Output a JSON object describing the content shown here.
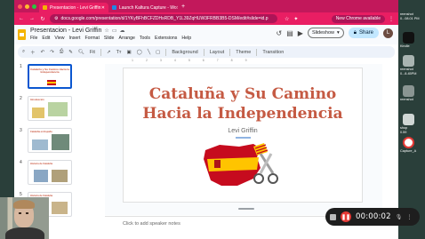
{
  "browser": {
    "tabs": [
      {
        "label": "Presentacion - Levi Griffin",
        "active": true,
        "favicon_color": "#f4b400"
      },
      {
        "label": "Launch Kaltura Capture - Wo",
        "active": false,
        "favicon_color": "#1e88e5"
      }
    ],
    "new_tab_glyph": "+",
    "url": "docs.google.com/presentation/d/1YKyBFhBCFZDHsRDB_Y1L39ZqHUW3FRBB3B5-DSM/edit#slide=id.p",
    "security_icon": "tune-icon",
    "new_chrome_label": "New Chrome available",
    "theme_color": "#e91e63"
  },
  "slides_app": {
    "doc_title": "Presentacion - Levi Griffin",
    "menus": [
      "File",
      "Edit",
      "View",
      "Insert",
      "Format",
      "Slide",
      "Arrange",
      "Tools",
      "Extensions",
      "Help"
    ],
    "slideshow_label": "Slideshow",
    "share_label": "Share",
    "avatar_initial": "L"
  },
  "toolbar": {
    "zoom_label": "Fit",
    "items": [
      "Background",
      "Layout",
      "Theme",
      "Transition"
    ]
  },
  "ruler_ticks": [
    "1",
    "2",
    "3",
    "4",
    "5",
    "6",
    "7",
    "8",
    "9"
  ],
  "filmstrip": {
    "slides": [
      {
        "num": "1",
        "title": "Cataluña y Su Camino Hacia la Independencia",
        "selected": true
      },
      {
        "num": "2",
        "title": "Introducción",
        "selected": false
      },
      {
        "num": "3",
        "title": "Cataluña en España",
        "selected": false
      },
      {
        "num": "4",
        "title": "Historia de Cataluña",
        "selected": false
      },
      {
        "num": "5",
        "title": "Historia de Cataluña",
        "selected": false
      }
    ]
  },
  "slide": {
    "title_line1": "Cataluña y Su Camino",
    "title_line2": "Hacia la Independencia",
    "subtitle": "Levi Griffin",
    "title_color": "#c55a43"
  },
  "notes": {
    "placeholder": "Click to add speaker notes"
  },
  "recorder": {
    "elapsed": "00:00:02"
  },
  "desktop": {
    "items": [
      {
        "label": "reenshot",
        "sub": "0...08.01 PM",
        "color": "#5a6b66"
      },
      {
        "label": "Kindle",
        "sub": "",
        "color": "#1a1a1a"
      },
      {
        "label": "reenshot",
        "sub": "0...8.45PM",
        "color": "#a9b4b1"
      },
      {
        "label": "reenshot",
        "sub": "",
        "color": "#8a9592"
      },
      {
        "label": "shop",
        "sub": "0.59",
        "color": "#cfd6d4"
      },
      {
        "label": "Capture_A",
        "sub": "",
        "color": "#e53935"
      }
    ]
  }
}
